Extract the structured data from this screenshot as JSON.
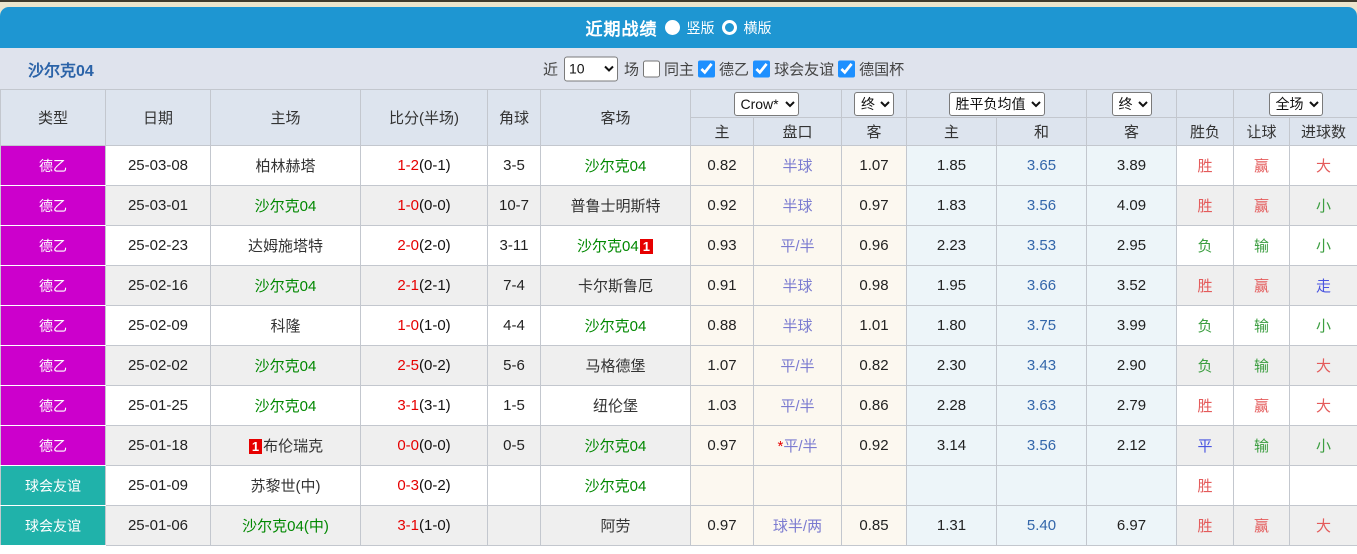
{
  "header": {
    "title": "近期战绩",
    "vertical_label": "竖版",
    "horizontal_label": "横版"
  },
  "toolbar": {
    "team": "沙尔克04",
    "near_label": "近",
    "count": "10",
    "games_label": "场",
    "same_home_label": "同主",
    "league_label": "德乙",
    "friendly_label": "球会友谊",
    "cup_label": "德国杯",
    "same_home_checked": false,
    "league_checked": true,
    "friendly_checked": true,
    "cup_checked": true
  },
  "colors": {
    "accent_blue": "#1e96d2",
    "league_magenta": "#cc00cc",
    "friendly_teal": "#20b2aa",
    "win_red": "#e45b5b",
    "lose_green": "#3c9e40",
    "draw_blue": "#4a55e0",
    "self_team_green": "#008800",
    "handicap_purple": "#7b7bd0",
    "score_red": "#e60000"
  },
  "table": {
    "left_headers": [
      "类型",
      "日期",
      "主场",
      "比分(半场)",
      "角球",
      "客场"
    ],
    "dropdowns": {
      "odds_source": "Crow*",
      "odds_time": "终",
      "avg_type": "胜平负均值",
      "avg_time": "终",
      "period": "全场"
    },
    "sub_headers": [
      "主",
      "盘口",
      "客",
      "主",
      "和",
      "客",
      "胜负",
      "让球",
      "进球数"
    ],
    "rows": [
      {
        "type": "德乙",
        "type_style": "league",
        "date": "25-03-08",
        "home": "柏林赫塔",
        "home_self": false,
        "home_card": "",
        "score_ft": "1-2",
        "score_ht": "(0-1)",
        "corners": "3-5",
        "away": "沙尔克04",
        "away_self": true,
        "away_card": "",
        "odds": [
          "0.82",
          "半球",
          "1.07"
        ],
        "handicap_star": "",
        "avg": [
          "1.85",
          "3.65",
          "3.89"
        ],
        "result": {
          "text": "胜",
          "color": "red"
        },
        "spread": {
          "text": "赢",
          "color": "red"
        },
        "goals": {
          "text": "大",
          "color": "red"
        }
      },
      {
        "type": "德乙",
        "type_style": "league",
        "date": "25-03-01",
        "home": "沙尔克04",
        "home_self": true,
        "home_card": "",
        "score_ft": "1-0",
        "score_ht": "(0-0)",
        "corners": "10-7",
        "away": "普鲁士明斯特",
        "away_self": false,
        "away_card": "",
        "odds": [
          "0.92",
          "半球",
          "0.97"
        ],
        "handicap_star": "",
        "avg": [
          "1.83",
          "3.56",
          "4.09"
        ],
        "result": {
          "text": "胜",
          "color": "red"
        },
        "spread": {
          "text": "赢",
          "color": "red"
        },
        "goals": {
          "text": "小",
          "color": "green"
        }
      },
      {
        "type": "德乙",
        "type_style": "league",
        "date": "25-02-23",
        "home": "达姆施塔特",
        "home_self": false,
        "home_card": "",
        "score_ft": "2-0",
        "score_ht": "(2-0)",
        "corners": "3-11",
        "away": "沙尔克04",
        "away_self": true,
        "away_card": "1",
        "odds": [
          "0.93",
          "平/半",
          "0.96"
        ],
        "handicap_star": "",
        "avg": [
          "2.23",
          "3.53",
          "2.95"
        ],
        "result": {
          "text": "负",
          "color": "green"
        },
        "spread": {
          "text": "输",
          "color": "green"
        },
        "goals": {
          "text": "小",
          "color": "green"
        }
      },
      {
        "type": "德乙",
        "type_style": "league",
        "date": "25-02-16",
        "home": "沙尔克04",
        "home_self": true,
        "home_card": "",
        "score_ft": "2-1",
        "score_ht": "(2-1)",
        "corners": "7-4",
        "away": "卡尔斯鲁厄",
        "away_self": false,
        "away_card": "",
        "odds": [
          "0.91",
          "半球",
          "0.98"
        ],
        "handicap_star": "",
        "avg": [
          "1.95",
          "3.66",
          "3.52"
        ],
        "result": {
          "text": "胜",
          "color": "red"
        },
        "spread": {
          "text": "赢",
          "color": "red"
        },
        "goals": {
          "text": "走",
          "color": "blue"
        }
      },
      {
        "type": "德乙",
        "type_style": "league",
        "date": "25-02-09",
        "home": "科隆",
        "home_self": false,
        "home_card": "",
        "score_ft": "1-0",
        "score_ht": "(1-0)",
        "corners": "4-4",
        "away": "沙尔克04",
        "away_self": true,
        "away_card": "",
        "odds": [
          "0.88",
          "半球",
          "1.01"
        ],
        "handicap_star": "",
        "avg": [
          "1.80",
          "3.75",
          "3.99"
        ],
        "result": {
          "text": "负",
          "color": "green"
        },
        "spread": {
          "text": "输",
          "color": "green"
        },
        "goals": {
          "text": "小",
          "color": "green"
        }
      },
      {
        "type": "德乙",
        "type_style": "league",
        "date": "25-02-02",
        "home": "沙尔克04",
        "home_self": true,
        "home_card": "",
        "score_ft": "2-5",
        "score_ht": "(0-2)",
        "corners": "5-6",
        "away": "马格德堡",
        "away_self": false,
        "away_card": "",
        "odds": [
          "1.07",
          "平/半",
          "0.82"
        ],
        "handicap_star": "",
        "avg": [
          "2.30",
          "3.43",
          "2.90"
        ],
        "result": {
          "text": "负",
          "color": "green"
        },
        "spread": {
          "text": "输",
          "color": "green"
        },
        "goals": {
          "text": "大",
          "color": "red"
        }
      },
      {
        "type": "德乙",
        "type_style": "league",
        "date": "25-01-25",
        "home": "沙尔克04",
        "home_self": true,
        "home_card": "",
        "score_ft": "3-1",
        "score_ht": "(3-1)",
        "corners": "1-5",
        "away": "纽伦堡",
        "away_self": false,
        "away_card": "",
        "odds": [
          "1.03",
          "平/半",
          "0.86"
        ],
        "handicap_star": "",
        "avg": [
          "2.28",
          "3.63",
          "2.79"
        ],
        "result": {
          "text": "胜",
          "color": "red"
        },
        "spread": {
          "text": "赢",
          "color": "red"
        },
        "goals": {
          "text": "大",
          "color": "red"
        }
      },
      {
        "type": "德乙",
        "type_style": "league",
        "date": "25-01-18",
        "home": "布伦瑞克",
        "home_self": false,
        "home_card": "1",
        "score_ft": "0-0",
        "score_ht": "(0-0)",
        "corners": "0-5",
        "away": "沙尔克04",
        "away_self": true,
        "away_card": "",
        "odds": [
          "0.97",
          "平/半",
          "0.92"
        ],
        "handicap_star": "*",
        "avg": [
          "3.14",
          "3.56",
          "2.12"
        ],
        "result": {
          "text": "平",
          "color": "blue"
        },
        "spread": {
          "text": "输",
          "color": "green"
        },
        "goals": {
          "text": "小",
          "color": "green"
        }
      },
      {
        "type": "球会友谊",
        "type_style": "friendly",
        "date": "25-01-09",
        "home": "苏黎世(中)",
        "home_self": false,
        "home_card": "",
        "score_ft": "0-3",
        "score_ht": "(0-2)",
        "corners": "",
        "away": "沙尔克04",
        "away_self": true,
        "away_card": "",
        "odds": [
          "",
          "",
          ""
        ],
        "handicap_star": "",
        "avg": [
          "",
          "",
          ""
        ],
        "result": {
          "text": "胜",
          "color": "red"
        },
        "spread": {
          "text": "",
          "color": ""
        },
        "goals": {
          "text": "",
          "color": ""
        }
      },
      {
        "type": "球会友谊",
        "type_style": "friendly",
        "date": "25-01-06",
        "home": "沙尔克04(中)",
        "home_self": true,
        "home_card": "",
        "score_ft": "3-1",
        "score_ht": "(1-0)",
        "corners": "",
        "away": "阿劳",
        "away_self": false,
        "away_card": "",
        "odds": [
          "0.97",
          "球半/两",
          "0.85"
        ],
        "handicap_star": "",
        "avg": [
          "1.31",
          "5.40",
          "6.97"
        ],
        "result": {
          "text": "胜",
          "color": "red"
        },
        "spread": {
          "text": "赢",
          "color": "red"
        },
        "goals": {
          "text": "大",
          "color": "red"
        }
      }
    ]
  }
}
